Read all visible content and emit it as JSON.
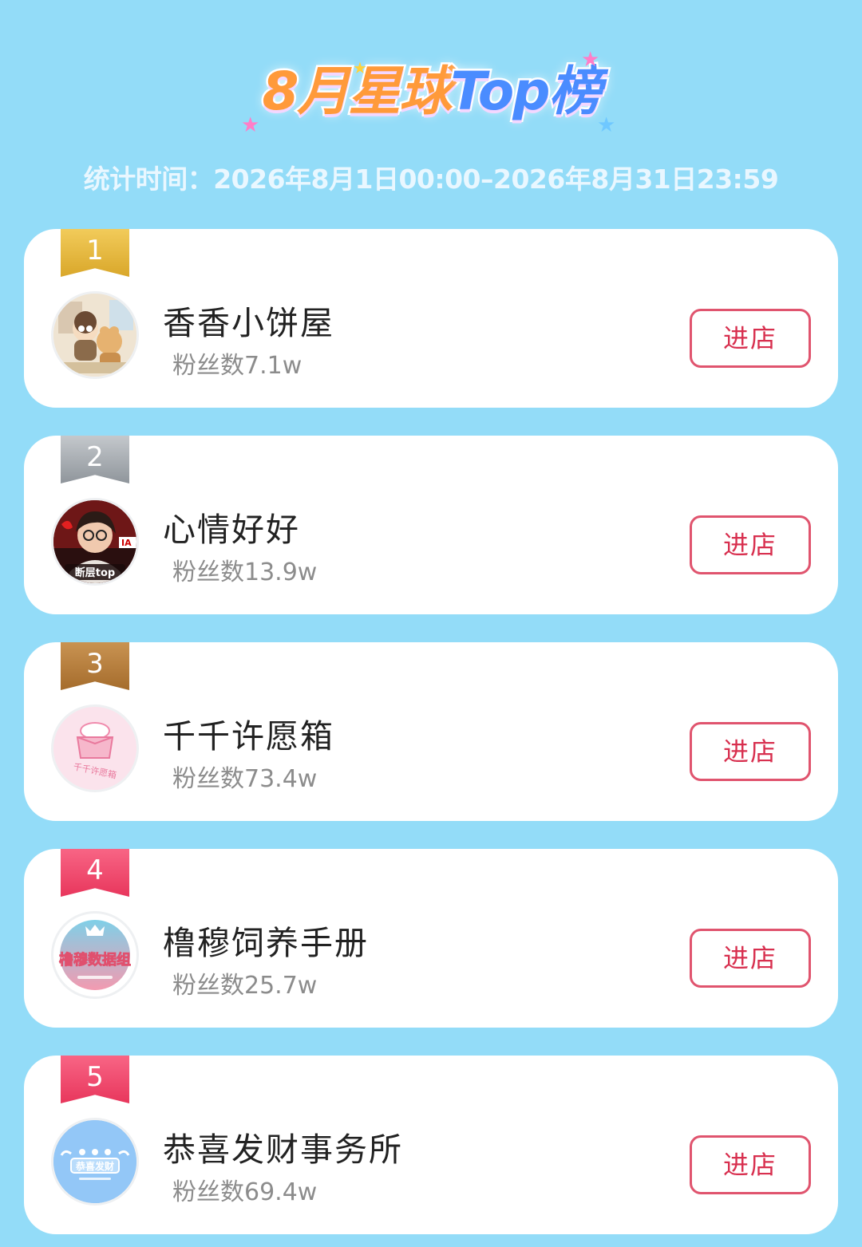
{
  "header": {
    "title_part1": "8月星球",
    "title_part2": "Top榜",
    "stat_period": "统计时间：2026年8月1日00:00–2026年8月31日23:59"
  },
  "colors": {
    "background": "#93dcf8",
    "rank_gold": "#e9b93c",
    "rank_silver": "#9aa0a6",
    "rank_bronze": "#b9803e",
    "rank_red": "#f0476a",
    "button_border": "#e0546e"
  },
  "shops": [
    {
      "rank": "1",
      "name": "香香小饼屋",
      "fans": "粉丝数7.1w",
      "button": "进店",
      "avatar_icon": "plush-toys-photo-icon"
    },
    {
      "rank": "2",
      "name": "心情好好",
      "fans": "粉丝数13.9w",
      "button": "进店",
      "avatar_icon": "singer-portrait-icon",
      "avatar_text": "断层top"
    },
    {
      "rank": "3",
      "name": "千千许愿箱",
      "fans": "粉丝数73.4w",
      "button": "进店",
      "avatar_icon": "wish-box-logo-icon",
      "avatar_text": "千千许愿箱"
    },
    {
      "rank": "4",
      "name": "橹穆饲养手册",
      "fans": "粉丝数25.7w",
      "button": "进店",
      "avatar_icon": "data-group-logo-icon",
      "avatar_text": "橹穆数据组"
    },
    {
      "rank": "5",
      "name": "恭喜发财事务所",
      "fans": "粉丝数69.4w",
      "button": "进店",
      "avatar_icon": "gongxi-logo-icon",
      "avatar_text": "恭喜发财"
    }
  ]
}
